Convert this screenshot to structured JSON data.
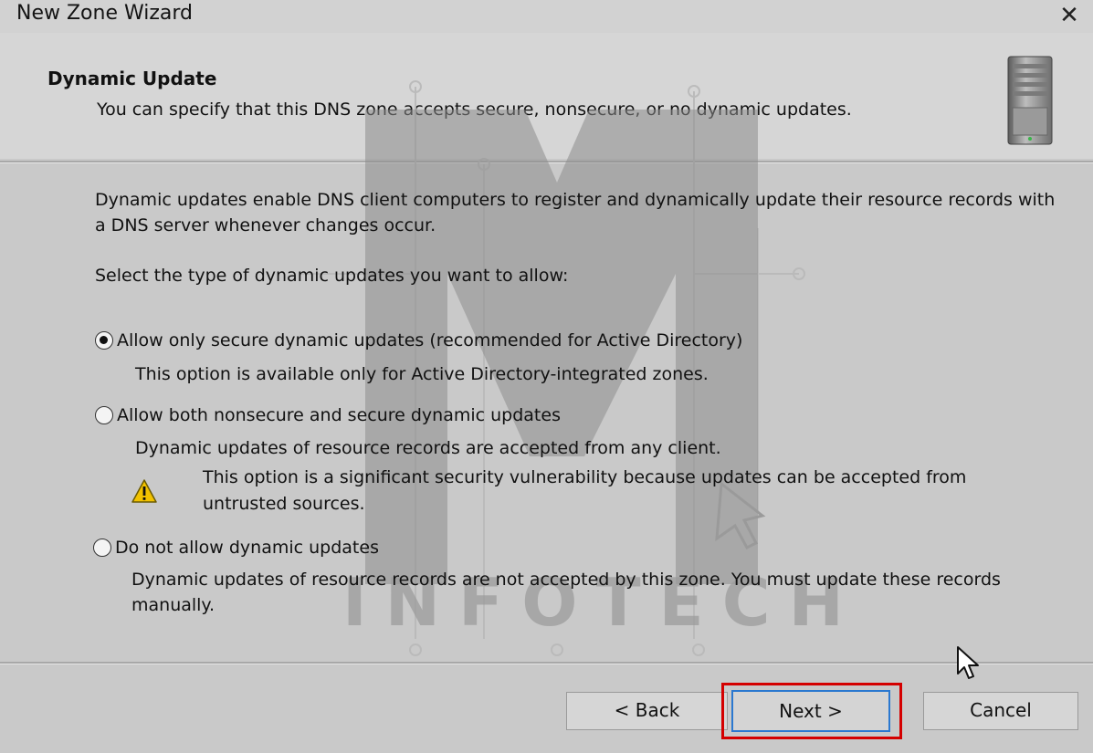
{
  "window": {
    "title": "New Zone Wizard",
    "close_glyph": "✕"
  },
  "header": {
    "title": "Dynamic Update",
    "description": "You can specify that this DNS zone accepts secure, nonsecure, or no dynamic updates.",
    "icon": "server-tower-icon"
  },
  "body": {
    "intro": "Dynamic updates enable DNS client computers to register and dynamically update their resource records with a DNS server whenever changes occur.",
    "prompt": "Select the type of dynamic updates you want to allow:",
    "options": [
      {
        "label": "Allow only secure dynamic updates (recommended for Active Directory)",
        "description": "This option is available only for Active Directory-integrated zones.",
        "selected": true
      },
      {
        "label": "Allow both nonsecure and secure dynamic updates",
        "description": "Dynamic updates of resource records are accepted from any client.",
        "warning": "This option is a significant security vulnerability because updates can be accepted from untrusted sources.",
        "warning_icon": "warning-triangle-icon",
        "selected": false
      },
      {
        "label": "Do not allow dynamic updates",
        "description": "Dynamic updates of resource records are not accepted by this zone. You must update these records manually.",
        "selected": false
      }
    ]
  },
  "footer": {
    "back_label": "< Back",
    "next_label": "Next >",
    "cancel_label": "Cancel",
    "highlight_color": "#d40000"
  },
  "watermark": {
    "text": "INFOTECH"
  }
}
